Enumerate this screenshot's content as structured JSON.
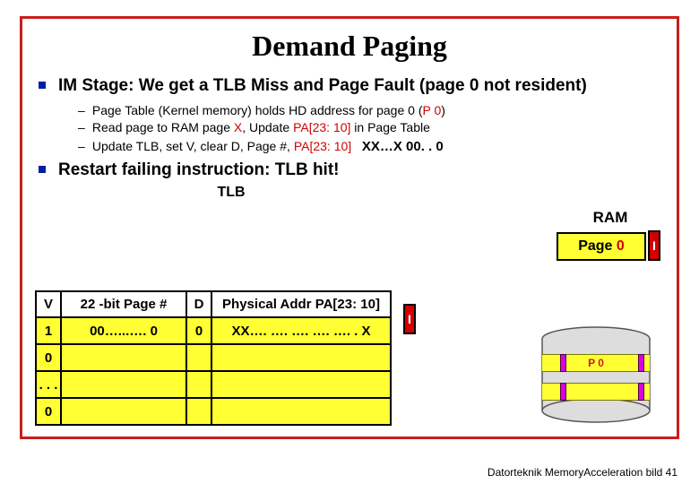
{
  "title": "Demand Paging",
  "bullets": {
    "b1": "IM Stage: We get a TLB Miss and Page Fault (page 0 not resident)",
    "s1_a": "Page Table (Kernel memory) holds HD address for page 0 (",
    "s1_b": "P 0",
    "s1_c": ")",
    "s2_a": "Read page to RAM page ",
    "s2_b": "X",
    "s2_c": ", Update ",
    "s2_d": "PA[23: 10]",
    "s2_e": " in Page Table",
    "s3_a": "Update TLB, set V, clear D, Page #, ",
    "s3_b": "PA[23: 10]",
    "s3_tail": "XX…X 00. . 0",
    "b2": "Restart failing instruction: TLB hit!"
  },
  "ram": {
    "label": "RAM",
    "page0": "Page 0",
    "ibox": "I"
  },
  "tlb": {
    "label": "TLB",
    "headers": {
      "v": "V",
      "pn": "22 -bit Page #",
      "d": "D",
      "pa": "Physical Addr PA[23: 10]"
    },
    "row1": {
      "v": "1",
      "pn": "00…...…. 0",
      "d": "0",
      "pa": "XX…. …. …. …. …. . X"
    },
    "row2v": "0",
    "rowdots": ". . .",
    "row4v": "0",
    "ibox": "I"
  },
  "disk": {
    "p0": "P 0"
  },
  "footer": "Datorteknik MemoryAcceleration bild 41"
}
